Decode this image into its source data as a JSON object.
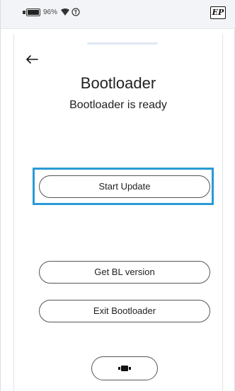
{
  "status_bar": {
    "battery_text": "96%",
    "icons": [
      "battery-icon",
      "wifi-icon",
      "alarm-icon",
      "ep-logo-icon"
    ],
    "logo_text": "EP"
  },
  "page": {
    "title": "Bootloader",
    "subtitle": "Bootloader is ready"
  },
  "buttons": {
    "start_update": "Start Update",
    "get_bl_version": "Get BL version",
    "exit_bootloader": "Exit Bootloader"
  },
  "colors": {
    "highlight": "#2a9ad6",
    "status_bar_bg": "#f2f4f7"
  }
}
